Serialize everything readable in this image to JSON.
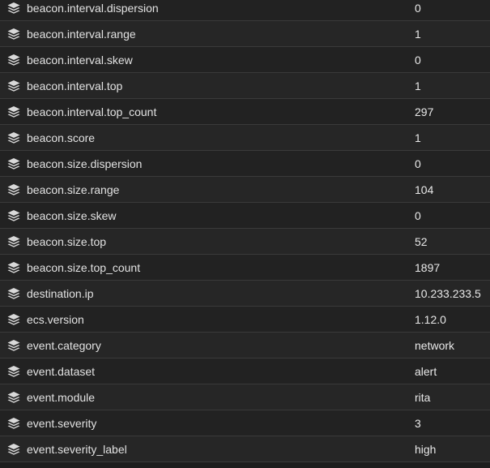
{
  "row_icon": "layers-icon",
  "rows": [
    {
      "field": "beacon.interval.dispersion",
      "value": "0"
    },
    {
      "field": "beacon.interval.range",
      "value": "1"
    },
    {
      "field": "beacon.interval.skew",
      "value": "0"
    },
    {
      "field": "beacon.interval.top",
      "value": "1"
    },
    {
      "field": "beacon.interval.top_count",
      "value": "297"
    },
    {
      "field": "beacon.score",
      "value": "1"
    },
    {
      "field": "beacon.size.dispersion",
      "value": "0"
    },
    {
      "field": "beacon.size.range",
      "value": "104"
    },
    {
      "field": "beacon.size.skew",
      "value": "0"
    },
    {
      "field": "beacon.size.top",
      "value": "52"
    },
    {
      "field": "beacon.size.top_count",
      "value": "1897"
    },
    {
      "field": "destination.ip",
      "value": "10.233.233.5"
    },
    {
      "field": "ecs.version",
      "value": "1.12.0"
    },
    {
      "field": "event.category",
      "value": "network"
    },
    {
      "field": "event.dataset",
      "value": "alert"
    },
    {
      "field": "event.module",
      "value": "rita"
    },
    {
      "field": "event.severity",
      "value": "3"
    },
    {
      "field": "event.severity_label",
      "value": "high"
    }
  ]
}
